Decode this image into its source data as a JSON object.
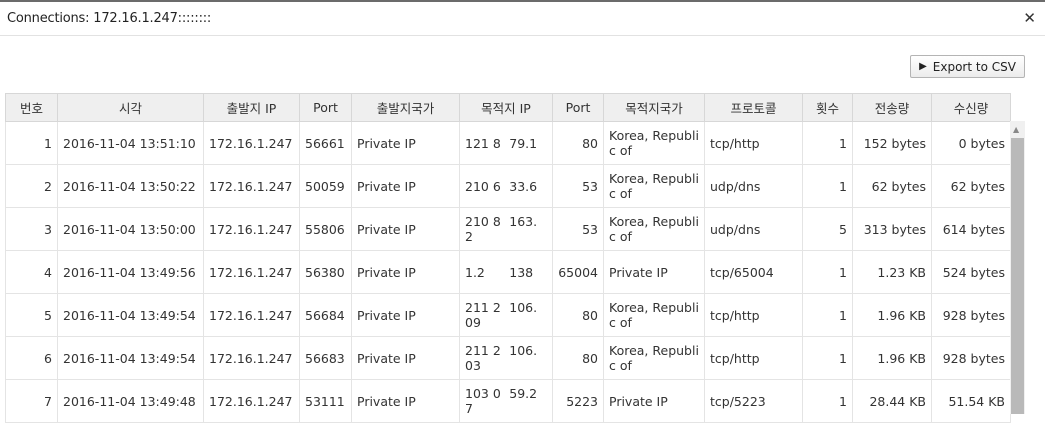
{
  "window": {
    "title": "Connections: 172.16.1.247::::::::"
  },
  "toolbar": {
    "export_label": "Export to CSV"
  },
  "table": {
    "headers": [
      "번호",
      "시각",
      "출발지 IP",
      "Port",
      "출발지국가",
      "목적지 IP",
      "Port",
      "목적지국가",
      "프로토콜",
      "횟수",
      "전송량",
      "수신량"
    ],
    "rows": [
      {
        "no": "1",
        "time": "2016-11-04 13:51:10",
        "src_ip": "172.16.1.247",
        "src_port": "56661",
        "src_country": "Private IP",
        "dst_ip_a": "121 8",
        "dst_ip_b": "79.1",
        "dst_port": "80",
        "dst_country": "Korea, Republic of",
        "protocol": "tcp/http",
        "count": "1",
        "sent": "152 bytes",
        "recv": "0 bytes"
      },
      {
        "no": "2",
        "time": "2016-11-04 13:50:22",
        "src_ip": "172.16.1.247",
        "src_port": "50059",
        "src_country": "Private IP",
        "dst_ip_a": "210 6",
        "dst_ip_b": "33.6",
        "dst_port": "53",
        "dst_country": "Korea, Republic of",
        "protocol": "udp/dns",
        "count": "1",
        "sent": "62 bytes",
        "recv": "62 bytes"
      },
      {
        "no": "3",
        "time": "2016-11-04 13:50:00",
        "src_ip": "172.16.1.247",
        "src_port": "55806",
        "src_country": "Private IP",
        "dst_ip_a": "210 82",
        "dst_ip_b": "163.",
        "dst_port": "53",
        "dst_country": "Korea, Republic of",
        "protocol": "udp/dns",
        "count": "5",
        "sent": "313 bytes",
        "recv": "614 bytes"
      },
      {
        "no": "4",
        "time": "2016-11-04 13:49:56",
        "src_ip": "172.16.1.247",
        "src_port": "56380",
        "src_country": "Private IP",
        "dst_ip_a": "1.2",
        "dst_ip_b": "138",
        "dst_port": "65004",
        "dst_country": "Private IP",
        "protocol": "tcp/65004",
        "count": "1",
        "sent": "1.23 KB",
        "recv": "524 bytes"
      },
      {
        "no": "5",
        "time": "2016-11-04 13:49:54",
        "src_ip": "172.16.1.247",
        "src_port": "56684",
        "src_country": "Private IP",
        "dst_ip_a": "211 209",
        "dst_ip_b": "106.",
        "dst_port": "80",
        "dst_country": "Korea, Republic of",
        "protocol": "tcp/http",
        "count": "1",
        "sent": "1.96 KB",
        "recv": "928 bytes"
      },
      {
        "no": "6",
        "time": "2016-11-04 13:49:54",
        "src_ip": "172.16.1.247",
        "src_port": "56683",
        "src_country": "Private IP",
        "dst_ip_a": "211 203",
        "dst_ip_b": "106.",
        "dst_port": "80",
        "dst_country": "Korea, Republic of",
        "protocol": "tcp/http",
        "count": "1",
        "sent": "1.96 KB",
        "recv": "928 bytes"
      },
      {
        "no": "7",
        "time": "2016-11-04 13:49:48",
        "src_ip": "172.16.1.247",
        "src_port": "53111",
        "src_country": "Private IP",
        "dst_ip_a": "103 07",
        "dst_ip_b": "59.2",
        "dst_port": "5223",
        "dst_country": "Private IP",
        "protocol": "tcp/5223",
        "count": "1",
        "sent": "28.44 KB",
        "recv": "51.54 KB"
      }
    ]
  }
}
